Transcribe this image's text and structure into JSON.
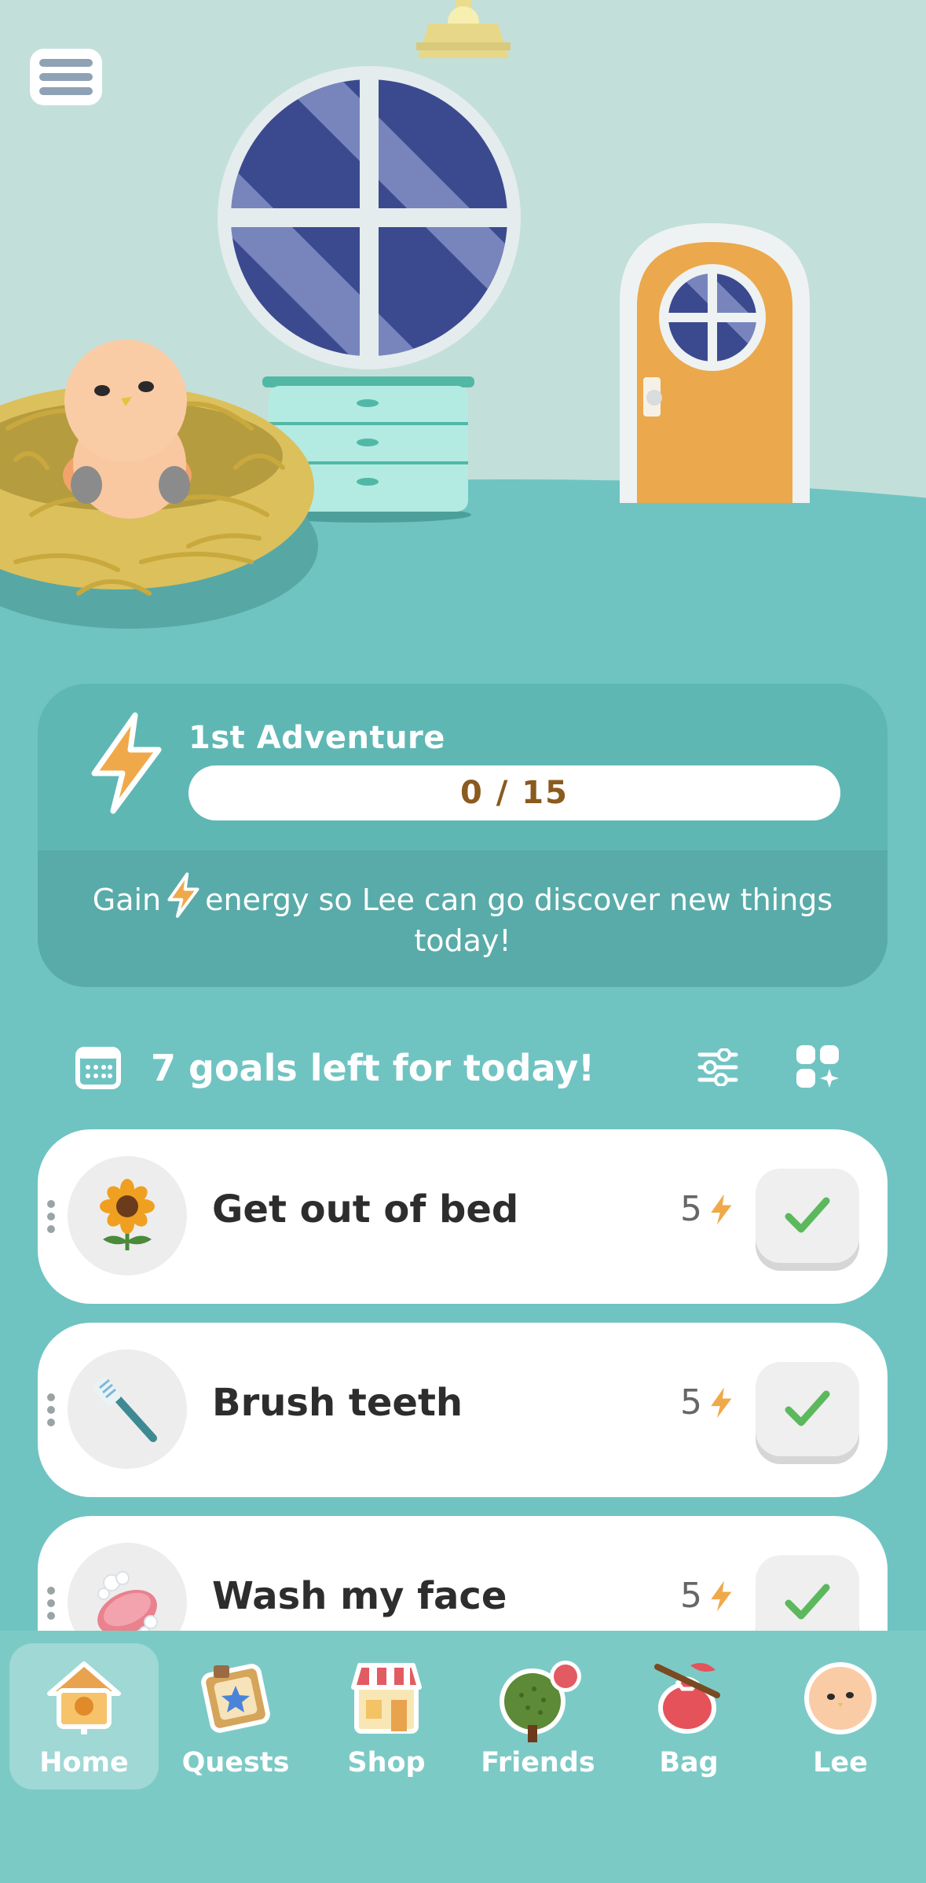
{
  "adventure": {
    "title": "1st Adventure",
    "progress_text": "0 / 15",
    "progress_fraction": 0,
    "message_before": "Gain",
    "message_after": "energy so Lee can go discover new things today!"
  },
  "goals": {
    "header": "7 goals left for today!",
    "items": [
      {
        "name": "Get out of bed",
        "reward": "5",
        "icon": "sunflower-icon"
      },
      {
        "name": "Brush teeth",
        "reward": "5",
        "icon": "toothbrush-icon"
      },
      {
        "name": "Wash my face",
        "reward": "5",
        "icon": "soap-icon"
      }
    ]
  },
  "nav": {
    "items": [
      {
        "label": "Home",
        "icon": "house-icon",
        "active": true
      },
      {
        "label": "Quests",
        "icon": "quest-board-icon",
        "active": false
      },
      {
        "label": "Shop",
        "icon": "shop-icon",
        "active": false
      },
      {
        "label": "Friends",
        "icon": "tree-icon",
        "active": false,
        "badge": true
      },
      {
        "label": "Bag",
        "icon": "bag-icon",
        "active": false
      },
      {
        "label": "Lee",
        "icon": "avatar-icon",
        "active": false
      }
    ]
  },
  "colors": {
    "background": "#6fc4c2",
    "wall": "#c3dfda",
    "energy": "#f0a94a",
    "check": "#5cb85c",
    "badge": "#e25b63"
  }
}
